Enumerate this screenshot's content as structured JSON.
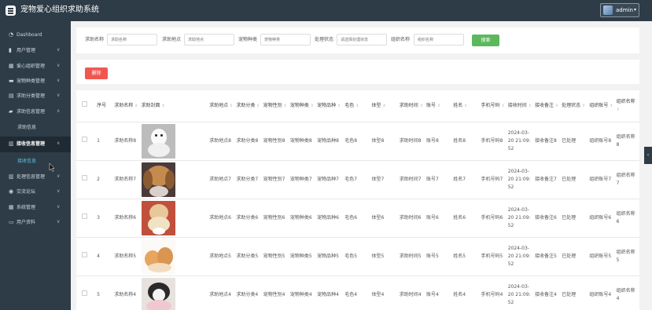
{
  "header": {
    "title": "宠物爱心组织求助系统",
    "user": "admin",
    "caret": "▾"
  },
  "sidebar": {
    "items": [
      {
        "label": "Dashboard",
        "icon": "dashboard-icon",
        "glyph": "◔",
        "chev": ""
      },
      {
        "label": "用户管理",
        "icon": "users-icon",
        "glyph": "▮",
        "chev": "∨"
      },
      {
        "label": "爱心组织管理",
        "icon": "grid-icon",
        "glyph": "▦",
        "chev": "∨"
      },
      {
        "label": "宠物种类管理",
        "icon": "monitor-icon",
        "glyph": "▬",
        "chev": "∨"
      },
      {
        "label": "求助分类管理",
        "icon": "tag-icon",
        "glyph": "▤",
        "chev": "∨"
      },
      {
        "label": "求助信息管理",
        "icon": "folder-icon",
        "glyph": "▰",
        "chev": "∧"
      },
      {
        "label": "接收信息管理",
        "icon": "list-icon",
        "glyph": "▥",
        "chev": "∧"
      },
      {
        "label": "处理信息管理",
        "icon": "list-icon",
        "glyph": "▥",
        "chev": "∨"
      },
      {
        "label": "交流论坛",
        "icon": "forum-icon",
        "glyph": "◉",
        "chev": "∨"
      },
      {
        "label": "系统管理",
        "icon": "settings-icon",
        "glyph": "▦",
        "chev": "∨"
      },
      {
        "label": "用户资料",
        "icon": "profile-icon",
        "glyph": "▭",
        "chev": "∨"
      }
    ],
    "sub_help": "求助信息",
    "sub_receive": "接收信息"
  },
  "search": {
    "fields": [
      {
        "label": "求助名称",
        "placeholder": "求助名称"
      },
      {
        "label": "求助地点",
        "placeholder": "求助地点"
      },
      {
        "label": "宠物种类",
        "placeholder": "宠物种类"
      },
      {
        "label": "处理状态",
        "placeholder": "请选择处理状态"
      },
      {
        "label": "组织名称",
        "placeholder": "组织名称"
      }
    ],
    "button": "搜索"
  },
  "actions": {
    "delete": "删除"
  },
  "table": {
    "sort_glyph": "⇕",
    "headers": [
      "序号",
      "求助名称",
      "求助封面",
      "求助地点",
      "求助分类",
      "宠物性别",
      "宠物种类",
      "宠物品种",
      "毛色",
      "体型",
      "求助时间",
      "账号",
      "姓名",
      "手机号码",
      "接收时间",
      "接收备注",
      "处理状态",
      "组织账号",
      "组织名称"
    ],
    "rows": [
      {
        "idx": "1",
        "name": "求助名称8",
        "addr": "求助地点8",
        "cat": "求助分类8",
        "sex": "宠物性别8",
        "kind": "宠物种类8",
        "breed": "宠物品种8",
        "color": "毛色8",
        "size": "体型8",
        "time": "求助时间8",
        "acct": "账号8",
        "uname": "姓名8",
        "phone": "手机号码8",
        "recv": "2024-03-20 21:09:52",
        "note": "接收备注8",
        "status": "已处理",
        "org_acct": "组织账号8",
        "org_name": "组织名称8"
      },
      {
        "idx": "2",
        "name": "求助名称7",
        "addr": "求助地点7",
        "cat": "求助分类7",
        "sex": "宠物性别7",
        "kind": "宠物种类7",
        "breed": "宠物品种7",
        "color": "毛色7",
        "size": "体型7",
        "time": "求助时间7",
        "acct": "账号7",
        "uname": "姓名7",
        "phone": "手机号码7",
        "recv": "2024-03-20 21:09:52",
        "note": "接收备注7",
        "status": "已处理",
        "org_acct": "组织账号7",
        "org_name": "组织名称7"
      },
      {
        "idx": "3",
        "name": "求助名称6",
        "addr": "求助地点6",
        "cat": "求助分类6",
        "sex": "宠物性别6",
        "kind": "宠物种类6",
        "breed": "宠物品种6",
        "color": "毛色6",
        "size": "体型6",
        "time": "求助时间6",
        "acct": "账号6",
        "uname": "姓名6",
        "phone": "手机号码6",
        "recv": "2024-03-20 21:09:52",
        "note": "接收备注6",
        "status": "已处理",
        "org_acct": "组织账号6",
        "org_name": "组织名称6"
      },
      {
        "idx": "4",
        "name": "求助名称5",
        "addr": "求助地点5",
        "cat": "求助分类5",
        "sex": "宠物性别5",
        "kind": "宠物种类5",
        "breed": "宠物品种5",
        "color": "毛色5",
        "size": "体型5",
        "time": "求助时间5",
        "acct": "账号5",
        "uname": "姓名5",
        "phone": "手机号码5",
        "recv": "2024-03-20 21:09:52",
        "note": "接收备注5",
        "status": "已处理",
        "org_acct": "组织账号5",
        "org_name": "组织名称5"
      },
      {
        "idx": "5",
        "name": "求助名称4",
        "addr": "求助地点4",
        "cat": "求助分类4",
        "sex": "宠物性别4",
        "kind": "宠物种类4",
        "breed": "宠物品种4",
        "color": "毛色4",
        "size": "体型4",
        "time": "求助时间4",
        "acct": "账号4",
        "uname": "姓名4",
        "phone": "手机号码4",
        "recv": "2024-03-20 21:09:52",
        "note": "接收备注4",
        "status": "已处理",
        "org_acct": "组织账号4",
        "org_name": "组织名称4"
      }
    ]
  },
  "side_tab": "‹",
  "colors": {
    "header": "#2e3c47",
    "search_button": "#5cb85c",
    "delete_button": "#f0574f",
    "active_sub": "#5bc0de"
  }
}
